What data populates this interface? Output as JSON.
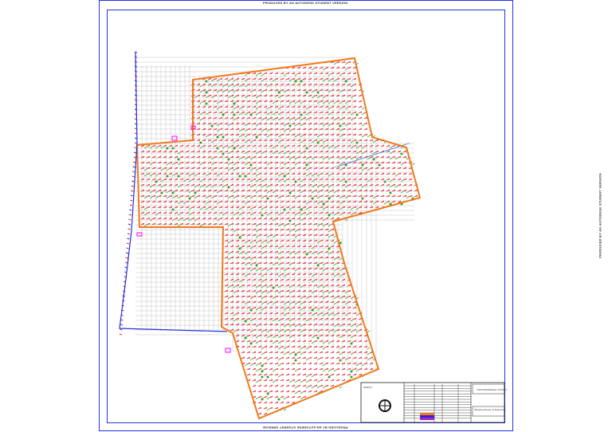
{
  "watermark": "PRODUCED BY AN AUTODESK STUDENT VERSION",
  "colors": {
    "frame": "#2233dd",
    "boundary": "#f07a1a",
    "grid": "#aaaaaa",
    "marker_red": "#e8202a",
    "marker_green": "#22bb33",
    "highlight": "#ff00ff"
  },
  "title_block": {
    "north_label": "NORTH",
    "title": "TOPOGRAPHICAL SURVEY",
    "subtitle": "Showing Survey of Engineers"
  }
}
